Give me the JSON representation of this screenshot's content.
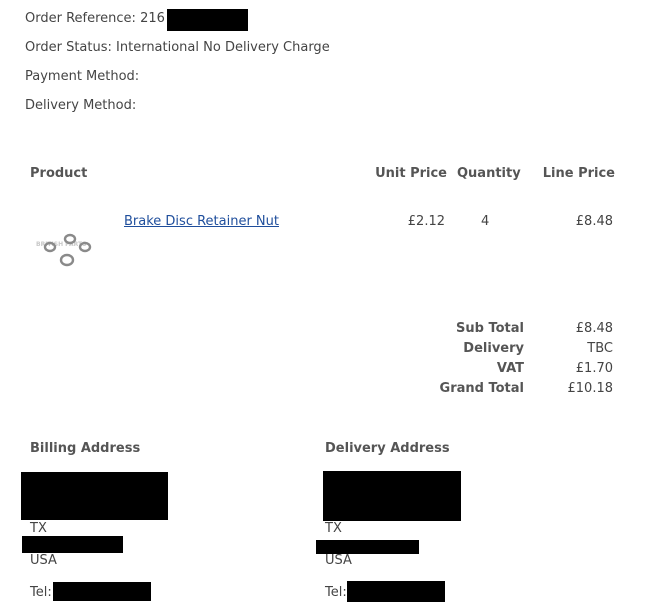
{
  "order": {
    "reference_label": "Order Reference:",
    "reference_value": "216",
    "status_label": "Order Status:",
    "status_value": "International No Delivery Charge",
    "payment_label": "Payment Method:",
    "delivery_method_label": "Delivery Method:"
  },
  "table": {
    "headers": {
      "product": "Product",
      "unit_price": "Unit Price",
      "quantity": "Quantity",
      "line_price": "Line Price"
    },
    "rows": [
      {
        "image_icon": "brake-disc-retainer-nut-image",
        "name": "Brake Disc Retainer Nut",
        "unit_price": "£2.12",
        "quantity": "4",
        "line_price": "£8.48"
      }
    ]
  },
  "totals": {
    "sub_total_label": "Sub Total",
    "sub_total_value": "£8.48",
    "delivery_label": "Delivery",
    "delivery_value": "TBC",
    "vat_label": "VAT",
    "vat_value": "£1.70",
    "grand_total_label": "Grand Total",
    "grand_total_value": "£10.18"
  },
  "billing": {
    "title": "Billing Address",
    "state": "TX",
    "country": "USA",
    "tel_label": "Tel:"
  },
  "delivery": {
    "title": "Delivery Address",
    "state": "TX",
    "country": "USA",
    "tel_label": "Tel:"
  },
  "colors": {
    "text": "#444444",
    "link": "#1f4e9c",
    "redaction": "#000000"
  }
}
